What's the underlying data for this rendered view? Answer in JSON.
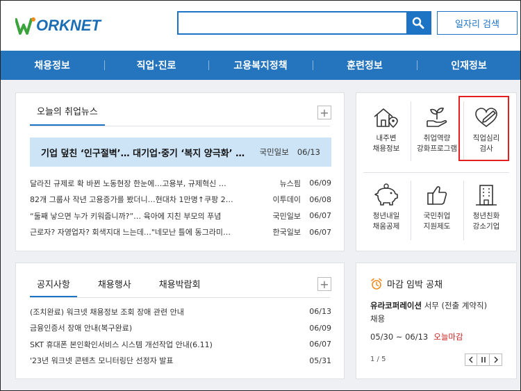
{
  "header": {
    "logo_text": "ORKNET",
    "search_placeholder": "",
    "job_search_label": "일자리 검색"
  },
  "nav": [
    {
      "label": "채용정보"
    },
    {
      "label": "직업·진로"
    },
    {
      "label": "고용복지정책"
    },
    {
      "label": "훈련정보"
    },
    {
      "label": "인재정보"
    }
  ],
  "news": {
    "title": "오늘의 취업뉴스",
    "headline": {
      "title": "기업 덮친 ‘인구절벽’… 대기업·중기 ‘복지 양극화’ …",
      "source": "국민일보",
      "date": "06/13"
    },
    "items": [
      {
        "title": "달라진 규제로 확 바뀐 노동현장 한눈에…고용부, 규제혁신 …",
        "source": "뉴스핌",
        "date": "06/09"
      },
      {
        "title": "82개 그룹사 작년 고용증가를 봤더니…현대차 1만명↑쿠팡 2…",
        "source": "이투데이",
        "date": "06/08"
      },
      {
        "title": "“둘째 낳으면 누가 키워줍니까?”… 육아에 지친 부모의 푸념",
        "source": "국민일보",
        "date": "06/07"
      },
      {
        "title": "근로자? 자영업자? 회색지대 느는데…\"네모난 틀에 동그라미…",
        "source": "한국일보",
        "date": "06/07"
      }
    ]
  },
  "notice": {
    "tabs": [
      {
        "label": "공지사항"
      },
      {
        "label": "채용행사"
      },
      {
        "label": "채용박람회"
      }
    ],
    "items": [
      {
        "title": "(조치완료) 워크넷 채용정보 조회 장애 관련 안내",
        "date": "06/13"
      },
      {
        "title": "금융인증서 장애 안내(복구완료)",
        "date": "06/09"
      },
      {
        "title": "SKT 휴대폰 본인확인서비스 시스템 개선작업 안내(6.11)",
        "date": "06/07"
      },
      {
        "title": "'23년 워크넷 콘텐츠 모니터링단 선정자 발표",
        "date": "05/31"
      }
    ]
  },
  "quick": [
    {
      "line1": "내주변",
      "line2": "채용정보",
      "icon": "house-pin-icon"
    },
    {
      "line1": "취업역량",
      "line2": "강화프로그램",
      "icon": "sprout-hand-icon"
    },
    {
      "line1": "직업심리",
      "line2": "검사",
      "icon": "heart-pen-icon"
    },
    {
      "line1": "청년내일",
      "line2": "채움공제",
      "icon": "piggy-bank-icon"
    },
    {
      "line1": "국민취업",
      "line2": "지원제도",
      "icon": "thumbs-up-icon"
    },
    {
      "line1": "청년친화",
      "line2": "강소기업",
      "icon": "building-icon"
    }
  ],
  "deadline": {
    "title": "마감 임박 공채",
    "company": "유라코퍼레이션",
    "position": "서무 (전출 계약직)",
    "category": "채용",
    "dates": "05/30 ~ 06/13",
    "status": "오늘마감",
    "pager": "1 / 5"
  },
  "colors": {
    "brand": "#2575be",
    "accent": "#1e74c4",
    "urgent": "#c91f1f",
    "highlight_box": "#e41f1f"
  }
}
